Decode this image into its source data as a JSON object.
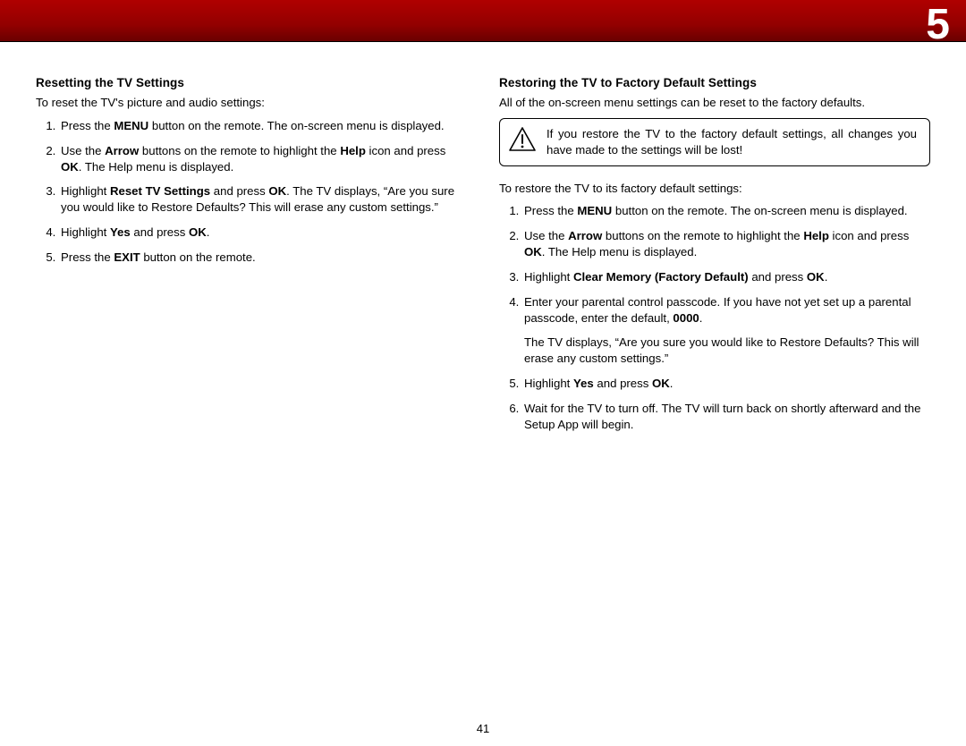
{
  "chapter": "5",
  "pageNumber": "41",
  "left": {
    "heading": "Resetting the TV Settings",
    "intro": "To reset the TV's picture and audio settings:",
    "steps": {
      "s1a": "Press the ",
      "s1b": "MENU",
      "s1c": " button on the remote. The on-screen menu is displayed.",
      "s2a": "Use the ",
      "s2b": "Arrow",
      "s2c": " buttons on the remote to highlight the ",
      "s2d": "Help",
      "s2e": " icon and press ",
      "s2f": "OK",
      "s2g": ". The Help menu is displayed.",
      "s3a": "Highlight ",
      "s3b": "Reset TV Settings",
      "s3c": " and press ",
      "s3d": "OK",
      "s3e": ". The TV displays, “Are you sure you would like to Restore Defaults? This will erase any custom settings.”",
      "s4a": "Highlight ",
      "s4b": "Yes",
      "s4c": " and press ",
      "s4d": "OK",
      "s4e": ".",
      "s5a": "Press the ",
      "s5b": "EXIT",
      "s5c": " button on the remote."
    }
  },
  "right": {
    "heading": "Restoring the TV to Factory Default Settings",
    "intro": "All of the on-screen menu settings can be reset to the factory defaults.",
    "callout": "If you restore the TV to the factory default settings, all changes you have made to the settings will be lost!",
    "intro2": "To restore the TV to its factory default settings:",
    "steps": {
      "s1a": "Press the ",
      "s1b": "MENU",
      "s1c": " button on the remote. The on-screen menu is displayed.",
      "s2a": "Use the ",
      "s2b": "Arrow",
      "s2c": " buttons on the remote to highlight the ",
      "s2d": "Help",
      "s2e": " icon and press ",
      "s2f": "OK",
      "s2g": ". The Help menu is displayed.",
      "s3a": "Highlight ",
      "s3b": "Clear Memory (Factory Default)",
      "s3c": " and press ",
      "s3d": "OK",
      "s3e": ".",
      "s4a": "Enter your parental control passcode. If you have not yet set up a parental passcode, enter the default, ",
      "s4b": "0000",
      "s4c": ".",
      "s4extra": "The TV displays, “Are you sure you would like to Restore Defaults? This will erase any custom settings.”",
      "s5a": "Highlight ",
      "s5b": "Yes",
      "s5c": " and press ",
      "s5d": "OK",
      "s5e": ".",
      "s6": "Wait for the TV to turn off. The TV will turn back on shortly afterward and the Setup App will begin."
    }
  }
}
